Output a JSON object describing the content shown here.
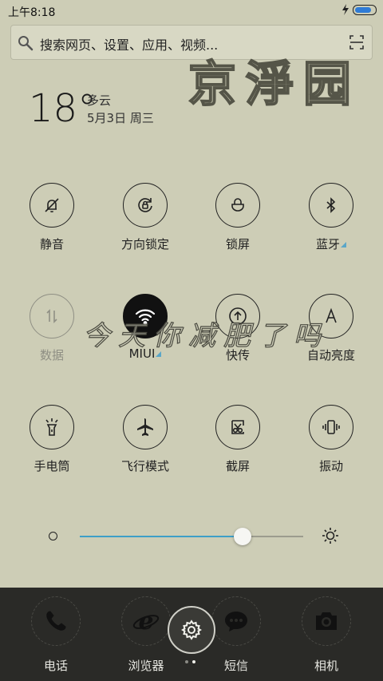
{
  "status": {
    "time": "上午8:18",
    "battery_level": 0.9,
    "icons": [
      "charging-icon",
      "battery-icon"
    ]
  },
  "search": {
    "placeholder": "搜索网页、设置、应用、视频..."
  },
  "watermark": {
    "top": "京淨园",
    "middle": "今天你减肥了吗"
  },
  "weather": {
    "temperature": "18°",
    "condition": "多云",
    "date": "5月3日 周三"
  },
  "toggles": [
    {
      "label": "静音",
      "icon": "mute-bell-icon",
      "state": "off"
    },
    {
      "label": "方向锁定",
      "icon": "rotation-lock-icon",
      "state": "off"
    },
    {
      "label": "锁屏",
      "icon": "lock-icon",
      "state": "off"
    },
    {
      "label": "蓝牙",
      "icon": "bluetooth-icon",
      "state": "off",
      "expandable": true
    },
    {
      "label": "数据",
      "icon": "mobile-data-icon",
      "state": "disabled"
    },
    {
      "label": "MIUI",
      "icon": "wifi-icon",
      "state": "on",
      "expandable": true
    },
    {
      "label": "快传",
      "icon": "quick-transfer-icon",
      "state": "off"
    },
    {
      "label": "自动亮度",
      "icon": "auto-brightness-icon",
      "state": "off"
    },
    {
      "label": "手电筒",
      "icon": "flashlight-icon",
      "state": "off"
    },
    {
      "label": "飞行模式",
      "icon": "airplane-icon",
      "state": "off"
    },
    {
      "label": "截屏",
      "icon": "screenshot-icon",
      "state": "off"
    },
    {
      "label": "振动",
      "icon": "vibrate-icon",
      "state": "off"
    }
  ],
  "brightness": {
    "level": 0.73,
    "accent": "#3d9fc7"
  },
  "dock": {
    "items": [
      {
        "label": "电话",
        "icon": "phone-icon"
      },
      {
        "label": "浏览器",
        "icon": "browser-icon"
      },
      {
        "label": "短信",
        "icon": "message-icon"
      },
      {
        "label": "相机",
        "icon": "camera-icon"
      }
    ],
    "settings_icon": "gear-icon",
    "page_count": 2,
    "active_page": 1
  }
}
